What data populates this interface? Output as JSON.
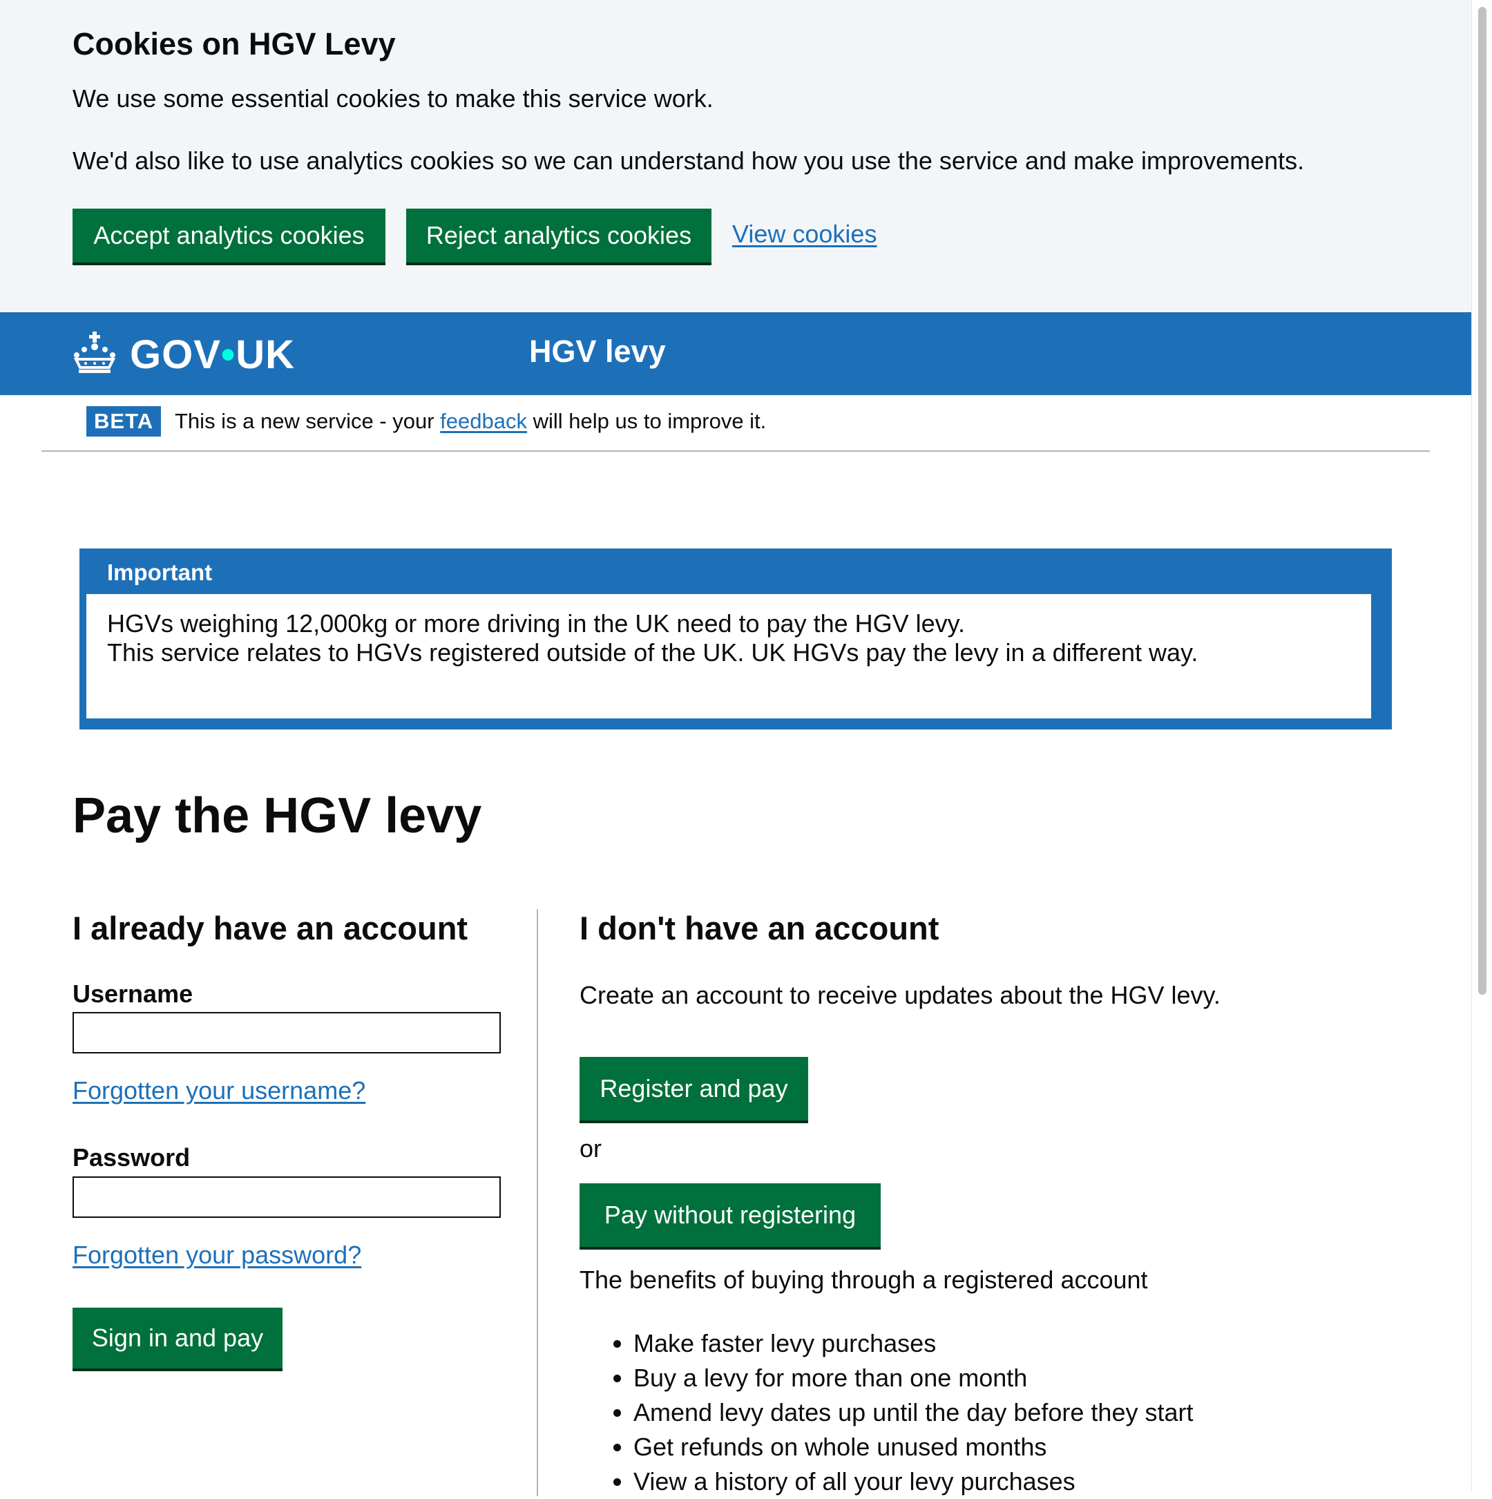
{
  "cookie_banner": {
    "title": "Cookies on HGV Levy",
    "paragraph1": "We use some essential cookies to make this service work.",
    "paragraph2": "We'd also like to use analytics cookies so we can understand how you use the service and make improvements.",
    "accept_label": "Accept analytics cookies",
    "reject_label": "Reject analytics cookies",
    "view_label": "View cookies"
  },
  "header": {
    "logo_gov": "GOV",
    "logo_dot": "•",
    "logo_uk": "UK",
    "service_name": "HGV levy",
    "icon": "crown-icon",
    "background": "#1d70b8"
  },
  "phase_banner": {
    "tag": "BETA",
    "text_before": "This is a new service - your ",
    "link": "feedback",
    "text_after": " will help us to improve it."
  },
  "notification": {
    "title": "Important",
    "line1": "HGVs weighing 12,000kg or more driving in the UK need to pay the HGV levy.",
    "line2": "This service relates to HGVs registered outside of the UK. UK HGVs pay the levy in a different way."
  },
  "main": {
    "title": "Pay the HGV levy",
    "account": {
      "heading": "I already have an account",
      "username_label": "Username",
      "username_value": "",
      "forgot_username": "Forgotten your username?",
      "password_label": "Password",
      "password_value": "",
      "forgot_password": "Forgotten your password?",
      "signin_label": "Sign in and pay"
    },
    "no_account": {
      "heading": "I don't have an account",
      "create_text": "Create an account to receive updates about the HGV levy.",
      "register_label": "Register and pay",
      "or_text": "or",
      "pay_without_label": "Pay without registering",
      "benefits_title": "The benefits of buying through a registered account",
      "benefits": [
        "Make faster levy purchases",
        "Buy a levy for more than one month",
        "Amend levy dates up until the day before they start",
        "Get refunds on whole unused months",
        "View a history of all your levy purchases"
      ]
    }
  },
  "colors": {
    "button_green": "#00703c",
    "link_blue": "#1d70b8",
    "banner_bg": "#f3f6f9"
  }
}
